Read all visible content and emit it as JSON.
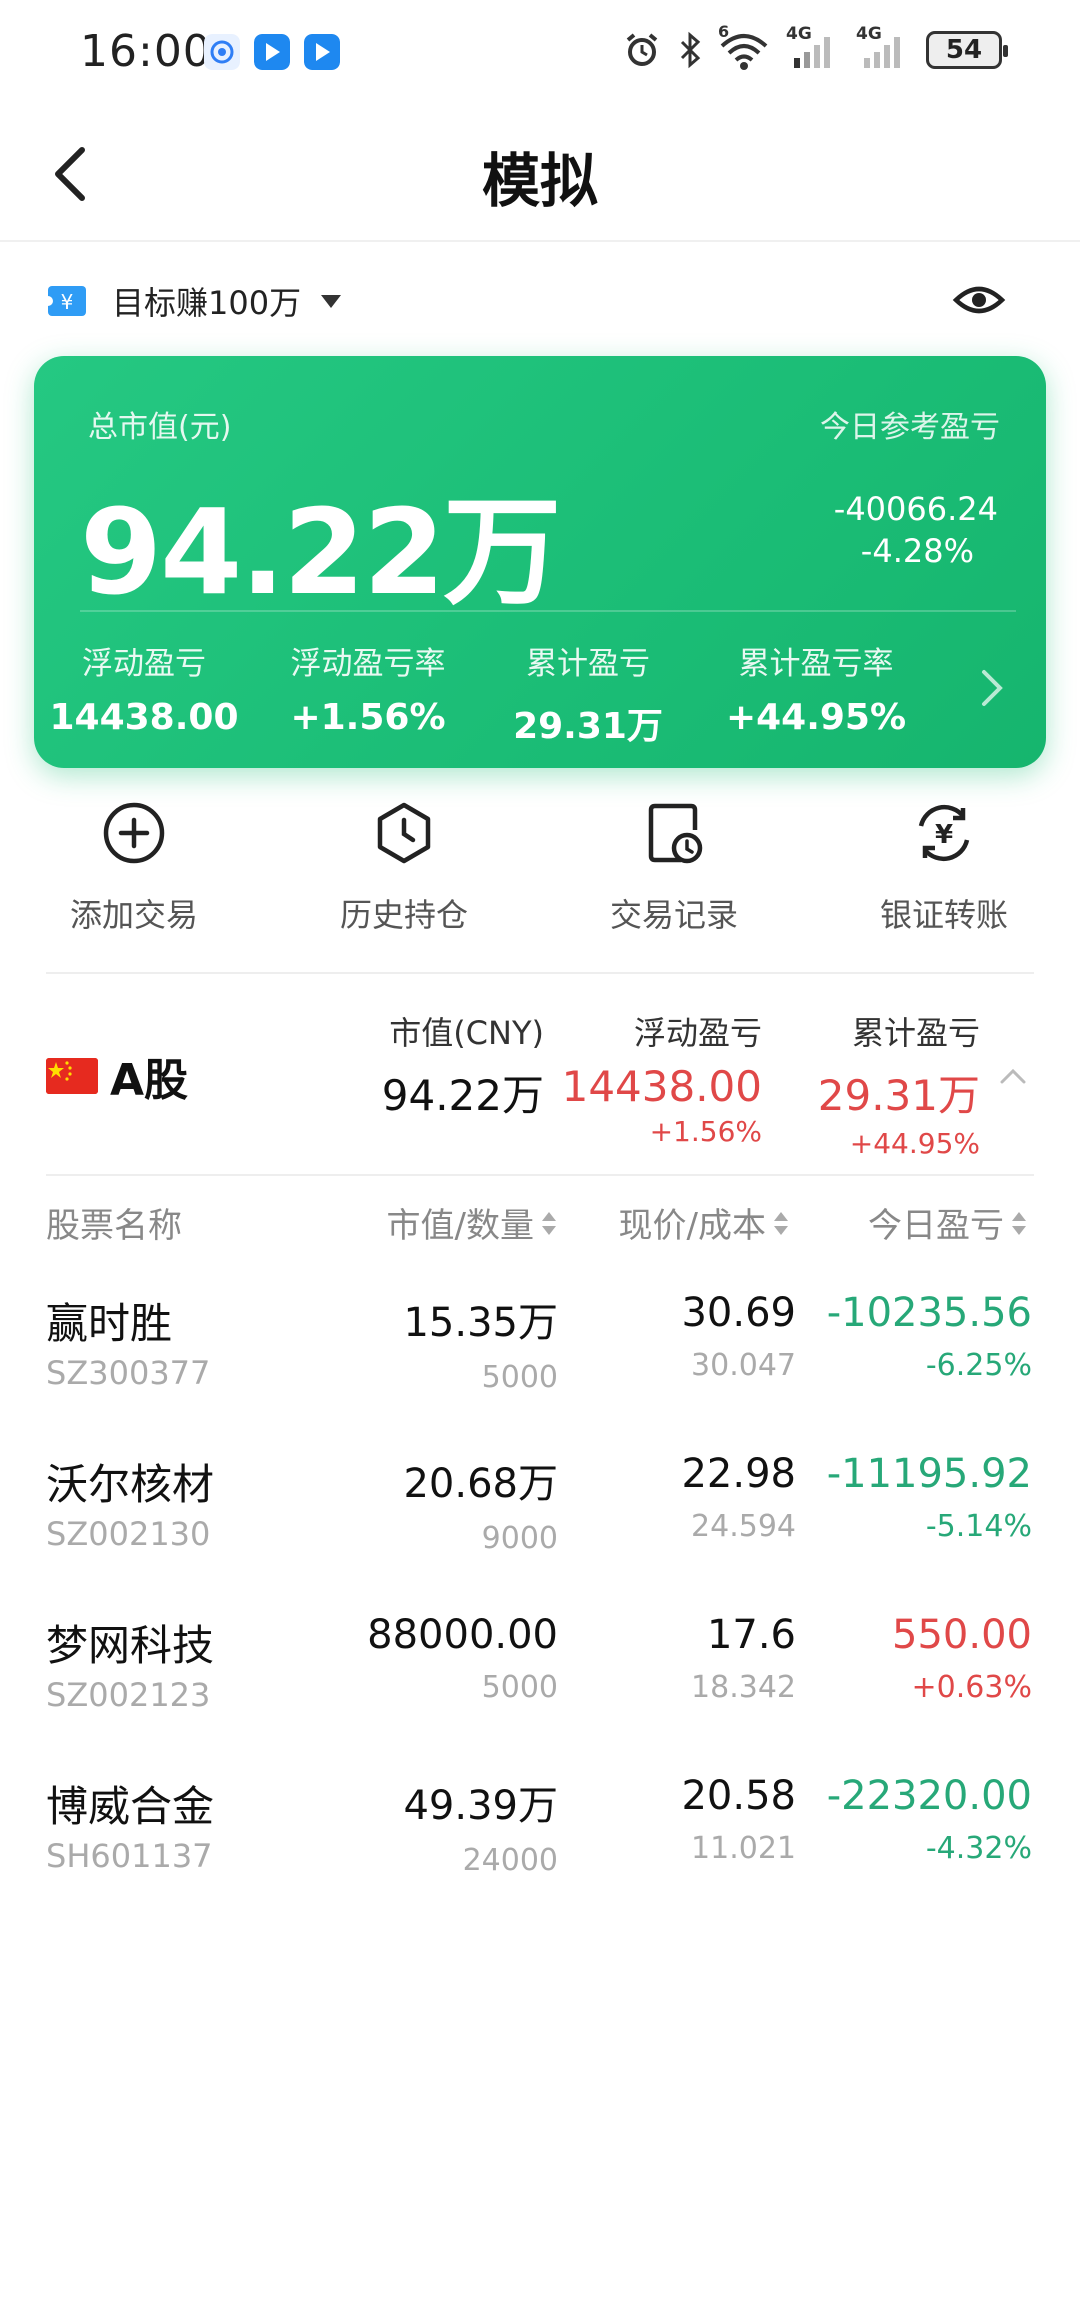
{
  "status_bar": {
    "time": "16:00",
    "battery": "54",
    "network_1": "4G",
    "network_2": "4G",
    "wifi_badge": "6"
  },
  "header": {
    "title": "模拟"
  },
  "account": {
    "name": "目标赚100万"
  },
  "summary": {
    "total_label": "总市值(元)",
    "total_value": "94.22万",
    "today_label": "今日参考盈亏",
    "today_value": "-40066.24",
    "today_pct": "-4.28%",
    "stats": [
      {
        "label": "浮动盈亏",
        "value": "14438.00"
      },
      {
        "label": "浮动盈亏率",
        "value": "+1.56%"
      },
      {
        "label": "累计盈亏",
        "value": "29.31万"
      },
      {
        "label": "累计盈亏率",
        "value": "+44.95%"
      }
    ]
  },
  "actions": [
    {
      "label": "添加交易",
      "icon": "plus-circle-icon"
    },
    {
      "label": "历史持仓",
      "icon": "clock-hexagon-icon"
    },
    {
      "label": "交易记录",
      "icon": "record-clock-icon"
    },
    {
      "label": "银证转账",
      "icon": "yuan-transfer-icon"
    }
  ],
  "market": {
    "name": "A股",
    "market_value_label": "市值(CNY)",
    "market_value": "94.22万",
    "float_pl_label": "浮动盈亏",
    "float_pl": "14438.00",
    "float_pl_pct": "+1.56%",
    "cum_pl_label": "累计盈亏",
    "cum_pl": "29.31万",
    "cum_pl_pct": "+44.95%"
  },
  "table": {
    "headers": {
      "name": "股票名称",
      "value_qty": "市值/数量",
      "price_cost": "现价/成本",
      "today_pl": "今日盈亏"
    },
    "rows": [
      {
        "name": "赢时胜",
        "code": "SZ300377",
        "value": "15.35万",
        "qty": "5000",
        "price": "30.69",
        "cost": "30.047",
        "pl": "-10235.56",
        "pl_pct": "-6.25%"
      },
      {
        "name": "沃尔核材",
        "code": "SZ002130",
        "value": "20.68万",
        "qty": "9000",
        "price": "22.98",
        "cost": "24.594",
        "pl": "-11195.92",
        "pl_pct": "-5.14%"
      },
      {
        "name": "梦网科技",
        "code": "SZ002123",
        "value": "88000.00",
        "qty": "5000",
        "price": "17.6",
        "cost": "18.342",
        "pl": "550.00",
        "pl_pct": "+0.63%"
      },
      {
        "name": "博威合金",
        "code": "SH601137",
        "value": "49.39万",
        "qty": "24000",
        "price": "20.58",
        "cost": "11.021",
        "pl": "-22320.00",
        "pl_pct": "-4.32%"
      }
    ]
  },
  "colors": {
    "accent_green": "#1bbd76",
    "up_red": "#e04848",
    "down_green": "#27a878"
  }
}
